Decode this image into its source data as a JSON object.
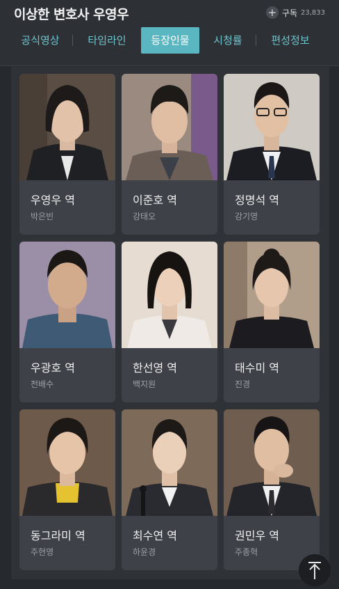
{
  "header": {
    "title": "이상한 변호사 우영우",
    "subscribe_label": "구독",
    "subscriber_count": "23,833"
  },
  "tabs": [
    {
      "label": "공식영상",
      "active": false
    },
    {
      "label": "타임라인",
      "active": false
    },
    {
      "label": "등장인물",
      "active": true
    },
    {
      "label": "시청률",
      "active": false
    },
    {
      "label": "편성정보",
      "active": false
    }
  ],
  "cast": [
    {
      "role": "우영우 역",
      "actor": "박은빈"
    },
    {
      "role": "이준호 역",
      "actor": "강태오"
    },
    {
      "role": "정명석 역",
      "actor": "강기영"
    },
    {
      "role": "우광호 역",
      "actor": "전배수"
    },
    {
      "role": "한선영 역",
      "actor": "백지원"
    },
    {
      "role": "태수미 역",
      "actor": "진경"
    },
    {
      "role": "동그라미 역",
      "actor": "주현영"
    },
    {
      "role": "최수연 역",
      "actor": "하윤경"
    },
    {
      "role": "권민우 역",
      "actor": "주종혁"
    }
  ],
  "colors": {
    "accent": "#5ab7c2",
    "tab_text": "#6ec6cf",
    "background": "#26292e",
    "card": "#3e4147"
  }
}
